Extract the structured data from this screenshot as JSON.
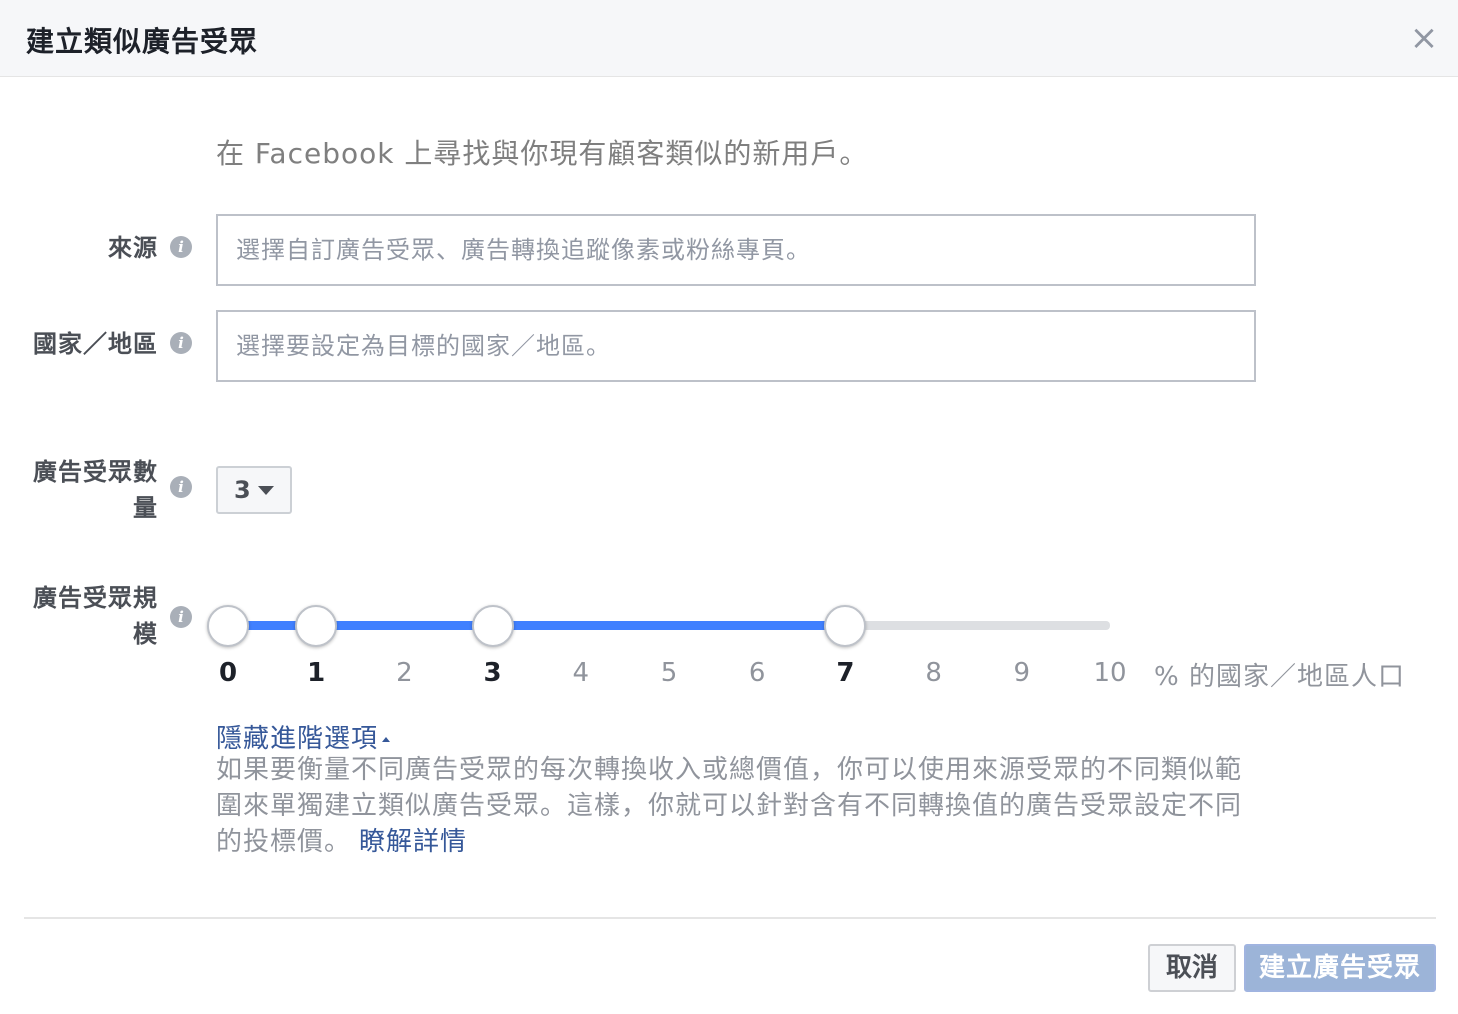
{
  "dialog": {
    "title": "建立類似廣告受眾",
    "close_label": "×"
  },
  "intro": "在 Facebook 上尋找與你現有顧客類似的新用戶。",
  "source": {
    "label": "來源",
    "placeholder": "選擇自訂廣告受眾、廣告轉換追蹤像素或粉絲專頁。"
  },
  "country": {
    "label": "國家／地區",
    "placeholder": "選擇要設定為目標的國家／地區。"
  },
  "audience_count": {
    "label_line1": "廣告受眾數",
    "label_line2": "量",
    "selected": "3"
  },
  "audience_size": {
    "label_line1": "廣告受眾規",
    "label_line2": "模",
    "ticks": [
      "0",
      "1",
      "2",
      "3",
      "4",
      "5",
      "6",
      "7",
      "8",
      "9",
      "10"
    ],
    "handle_values": [
      0,
      1,
      3,
      7
    ],
    "max": 10,
    "suffix": "% 的國家／地區人口",
    "fill_color": "#4080ff"
  },
  "advanced": {
    "toggle_label": "隱藏進階選項",
    "description": "如果要衡量不同廣告受眾的每次轉換收入或總價值，你可以使用來源受眾的不同類似範圍來單獨建立類似廣告受眾。這樣，你就可以針對含有不同轉換值的廣告受眾設定不同的投標價。",
    "learn_more": "瞭解詳情"
  },
  "footer": {
    "cancel_label": "取消",
    "create_label": "建立廣告受眾"
  },
  "info_icon": "info-icon"
}
